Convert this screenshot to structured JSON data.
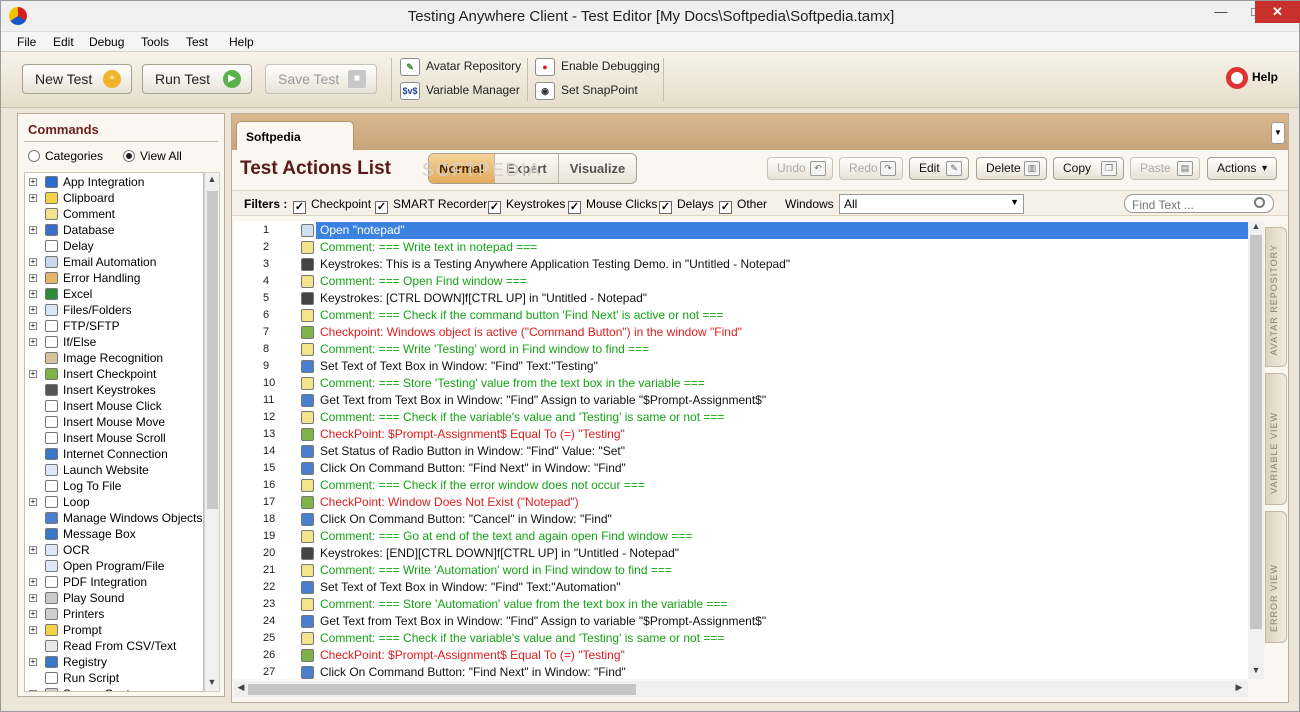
{
  "window": {
    "title": "Testing Anywhere Client - Test Editor [My Docs\\Softpedia\\Softpedia.tamx]",
    "min": "—",
    "max": "□",
    "close": "✕"
  },
  "menu": [
    "File",
    "Edit",
    "Debug",
    "Tools",
    "Test",
    "Help"
  ],
  "toolbar": {
    "new_test": "New Test",
    "run_test": "Run Test",
    "save_test": "Save Test",
    "avatar_repository": "Avatar Repository",
    "variable_manager": "Variable Manager",
    "enable_debugging": "Enable Debugging",
    "set_snappoint": "Set SnapPoint",
    "help": "Help"
  },
  "commands": {
    "title": "Commands",
    "radio_categories": "Categories",
    "radio_view_all": "View All",
    "items": [
      {
        "label": "App Integration",
        "icon": "app-integration-icon",
        "color": "#2d6bd0",
        "expand": true
      },
      {
        "label": "Clipboard",
        "icon": "clipboard-icon",
        "color": "#f2d34a",
        "expand": true
      },
      {
        "label": "Comment",
        "icon": "comment-icon",
        "color": "#f3e38a",
        "expand": false
      },
      {
        "label": "Database",
        "icon": "database-icon",
        "color": "#3b70c8",
        "expand": true
      },
      {
        "label": "Delay",
        "icon": "hourglass-icon",
        "color": "#ffffff",
        "expand": false
      },
      {
        "label": "Email Automation",
        "icon": "email-icon",
        "color": "#c8d8f0",
        "expand": true
      },
      {
        "label": "Error Handling",
        "icon": "error-handling-icon",
        "color": "#e6b36a",
        "expand": true
      },
      {
        "label": "Excel",
        "icon": "excel-icon",
        "color": "#2f8a3a",
        "expand": true
      },
      {
        "label": "Files/Folders",
        "icon": "folder-icon",
        "color": "#d8e7f6",
        "expand": true
      },
      {
        "label": "FTP/SFTP",
        "icon": "ftp-icon",
        "color": "#ffffff",
        "expand": true
      },
      {
        "label": "If/Else",
        "icon": "if-else-icon",
        "color": "#ffffff",
        "expand": true
      },
      {
        "label": "Image Recognition",
        "icon": "image-recognition-icon",
        "color": "#d9c29a",
        "expand": false
      },
      {
        "label": "Insert Checkpoint",
        "icon": "checkpoint-flag-icon",
        "color": "#7fb34a",
        "expand": true
      },
      {
        "label": "Insert Keystrokes",
        "icon": "keystroke-icon",
        "color": "#555555",
        "expand": false
      },
      {
        "label": "Insert Mouse Click",
        "icon": "mouse-click-icon",
        "color": "#ffffff",
        "expand": false
      },
      {
        "label": "Insert Mouse Move",
        "icon": "mouse-move-icon",
        "color": "#ffffff",
        "expand": false
      },
      {
        "label": "Insert Mouse Scroll",
        "icon": "mouse-scroll-icon",
        "color": "#ffffff",
        "expand": false
      },
      {
        "label": "Internet Connection",
        "icon": "globe-icon",
        "color": "#3a78c9",
        "expand": false
      },
      {
        "label": "Launch Website",
        "icon": "website-icon",
        "color": "#dce8f5",
        "expand": false
      },
      {
        "label": "Log To File",
        "icon": "log-file-icon",
        "color": "#ffffff",
        "expand": false
      },
      {
        "label": "Loop",
        "icon": "loop-icon",
        "color": "#ffffff",
        "expand": true
      },
      {
        "label": "Manage Windows Objects",
        "icon": "windows-objects-icon",
        "color": "#4a7fd0",
        "expand": false
      },
      {
        "label": "Message Box",
        "icon": "message-box-icon",
        "color": "#3a78c9",
        "expand": false
      },
      {
        "label": "OCR",
        "icon": "ocr-icon",
        "color": "#dce8f5",
        "expand": true
      },
      {
        "label": "Open Program/File",
        "icon": "open-program-icon",
        "color": "#dce8f5",
        "expand": false
      },
      {
        "label": "PDF Integration",
        "icon": "pdf-icon",
        "color": "#ffffff",
        "expand": true
      },
      {
        "label": "Play Sound",
        "icon": "speaker-icon",
        "color": "#c9c9c9",
        "expand": true
      },
      {
        "label": "Printers",
        "icon": "printer-icon",
        "color": "#cfcfcf",
        "expand": true
      },
      {
        "label": "Prompt",
        "icon": "prompt-icon",
        "color": "#f2d34a",
        "expand": true
      },
      {
        "label": "Read From CSV/Text",
        "icon": "csv-icon",
        "color": "#e8e8e8",
        "expand": false
      },
      {
        "label": "Registry",
        "icon": "registry-icon",
        "color": "#3a78c9",
        "expand": true
      },
      {
        "label": "Run Script",
        "icon": "script-icon",
        "color": "#ffffff",
        "expand": false
      },
      {
        "label": "Screen Capture",
        "icon": "screen-capture-icon",
        "color": "#cfcfcf",
        "expand": true
      }
    ]
  },
  "editor": {
    "tab": "Softpedia",
    "list_title": "Test Actions List",
    "watermark": "SOFTPEDIA",
    "views": [
      "Normal",
      "Expert",
      "Visualize"
    ],
    "actions": {
      "undo": "Undo",
      "redo": "Redo",
      "edit": "Edit",
      "delete": "Delete",
      "copy": "Copy",
      "paste": "Paste",
      "actions": "Actions"
    },
    "filters_label": "Filters :",
    "filters": [
      "Checkpoint",
      "SMART Recorder",
      "Keystrokes",
      "Mouse Clicks",
      "Delays",
      "Other"
    ],
    "windows_label": "Windows",
    "windows_value": "All",
    "find_placeholder": "Find Text ...",
    "rows": [
      {
        "n": "1",
        "t": "Open \"notepad\"",
        "k": "normal",
        "icon": "open-folder-icon"
      },
      {
        "n": "2",
        "t": "Comment: === Write text in notepad ===",
        "k": "comment",
        "icon": "comment-icon"
      },
      {
        "n": "3",
        "t": "Keystrokes: This is a Testing Anywhere Application Testing Demo. in \"Untitled - Notepad\"",
        "k": "normal",
        "icon": "keystroke-icon"
      },
      {
        "n": "4",
        "t": "Comment: === Open Find window ===",
        "k": "comment",
        "icon": "comment-icon"
      },
      {
        "n": "5",
        "t": "Keystrokes: [CTRL DOWN]f[CTRL UP] in \"Untitled - Notepad\"",
        "k": "normal",
        "icon": "keystroke-icon"
      },
      {
        "n": "6",
        "t": "Comment: === Check if the command button 'Find Next' is active or not ===",
        "k": "comment",
        "icon": "comment-icon"
      },
      {
        "n": "7",
        "t": "Checkpoint: Windows object is active (\"Command Button\") in the window \"Find\"",
        "k": "check",
        "icon": "checkpoint-flag-icon"
      },
      {
        "n": "8",
        "t": "Comment: === Write 'Testing' word in Find window to find ===",
        "k": "comment",
        "icon": "comment-icon"
      },
      {
        "n": "9",
        "t": "Set Text of Text Box in Window: \"Find\" Text:\"Testing\"",
        "k": "normal",
        "icon": "windows-object-icon"
      },
      {
        "n": "10",
        "t": "Comment: === Store 'Testing' value from the text box in the variable ===",
        "k": "comment",
        "icon": "comment-icon"
      },
      {
        "n": "11",
        "t": "Get Text from Text Box in Window: \"Find\" Assign to variable \"$Prompt-Assignment$\"",
        "k": "normal",
        "icon": "windows-object-icon"
      },
      {
        "n": "12",
        "t": "Comment: === Check if the variable's value and 'Testing' is same or not ===",
        "k": "comment",
        "icon": "comment-icon"
      },
      {
        "n": "13",
        "t": "CheckPoint: $Prompt-Assignment$ Equal To (=) \"Testing\"",
        "k": "check",
        "icon": "checkpoint-flag-icon"
      },
      {
        "n": "14",
        "t": "Set Status of Radio Button in Window: \"Find\" Value: \"Set\"",
        "k": "normal",
        "icon": "windows-object-icon"
      },
      {
        "n": "15",
        "t": "Click On Command Button: \"Find Next\" in Window: \"Find\"",
        "k": "normal",
        "icon": "windows-object-icon"
      },
      {
        "n": "16",
        "t": "Comment: === Check if the error window does not occur ===",
        "k": "comment",
        "icon": "comment-icon"
      },
      {
        "n": "17",
        "t": "CheckPoint: Window Does Not Exist (\"Notepad\")",
        "k": "check",
        "icon": "checkpoint-flag-icon"
      },
      {
        "n": "18",
        "t": "Click On Command Button: \"Cancel\" in Window: \"Find\"",
        "k": "normal",
        "icon": "windows-object-icon"
      },
      {
        "n": "19",
        "t": "Comment: === Go at end of the text and again open Find window ===",
        "k": "comment",
        "icon": "comment-icon"
      },
      {
        "n": "20",
        "t": "Keystrokes: [END][CTRL DOWN]f[CTRL UP] in \"Untitled - Notepad\"",
        "k": "normal",
        "icon": "keystroke-icon"
      },
      {
        "n": "21",
        "t": "Comment: === Write 'Automation' word in Find window to find ===",
        "k": "comment",
        "icon": "comment-icon"
      },
      {
        "n": "22",
        "t": "Set Text of Text Box in Window: \"Find\" Text:\"Automation\"",
        "k": "normal",
        "icon": "windows-object-icon"
      },
      {
        "n": "23",
        "t": "Comment: === Store 'Automation' value from the text box in the variable ===",
        "k": "comment",
        "icon": "comment-icon"
      },
      {
        "n": "24",
        "t": "Get Text from Text Box in Window: \"Find\" Assign to variable \"$Prompt-Assignment$\"",
        "k": "normal",
        "icon": "windows-object-icon"
      },
      {
        "n": "25",
        "t": "Comment: === Check if the variable's value and 'Testing' is same or not ===",
        "k": "comment",
        "icon": "comment-icon"
      },
      {
        "n": "26",
        "t": "CheckPoint: $Prompt-Assignment$ Equal To (=) \"Testing\"",
        "k": "check",
        "icon": "checkpoint-flag-icon"
      },
      {
        "n": "27",
        "t": "Click On Command Button: \"Find Next\" in Window: \"Find\"",
        "k": "normal",
        "icon": "windows-object-icon"
      }
    ]
  },
  "side_tabs": [
    "AVATAR REPOSITORY",
    "VARIABLE VIEW",
    "ERROR VIEW"
  ],
  "colors": {
    "comment": "#16a316",
    "checkpoint": "#e01c1c",
    "selection": "#3b82e0",
    "title": "#5a1a1a",
    "tab_strip": "#c9a47a"
  }
}
